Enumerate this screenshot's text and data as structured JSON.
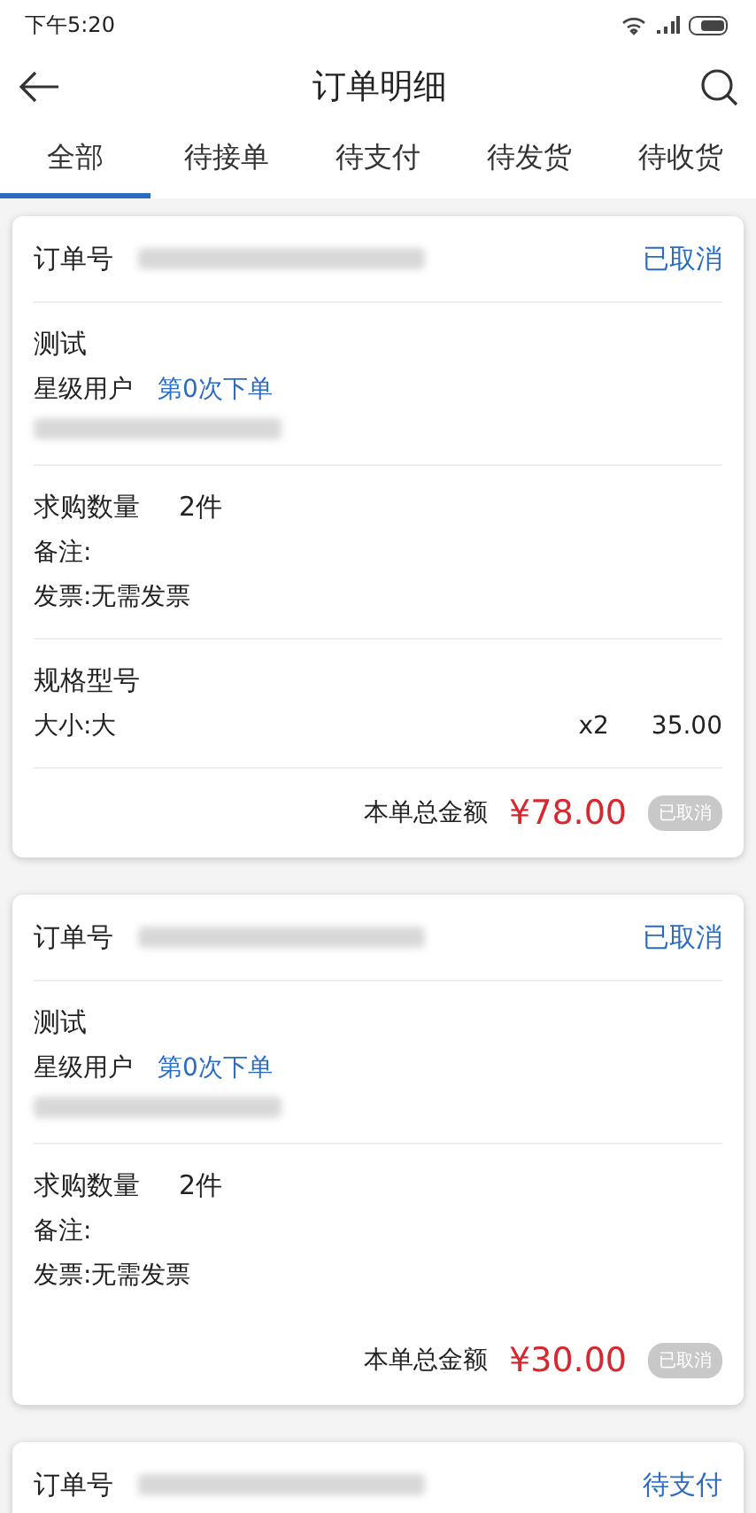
{
  "status_bar": {
    "time": "下午5:20"
  },
  "header": {
    "title": "订单明细"
  },
  "tabs": [
    {
      "label": "全部",
      "selected": true
    },
    {
      "label": "待接单",
      "selected": false
    },
    {
      "label": "待支付",
      "selected": false
    },
    {
      "label": "待发货",
      "selected": false
    },
    {
      "label": "待收货",
      "selected": false
    }
  ],
  "orders": [
    {
      "order_label": "订单号",
      "status": "已取消",
      "buyer": "测试",
      "user_level": "星级用户",
      "order_count": "第0次下单",
      "quantity_label": "求购数量",
      "quantity": "2件",
      "note": "备注:",
      "invoice": "发票:无需发票",
      "spec_title": "规格型号",
      "specs": [
        {
          "name": "大小:大",
          "count": "x2",
          "price": "35.00"
        }
      ],
      "total_label": "本单总金额",
      "total": "¥78.00",
      "badge": "已取消"
    },
    {
      "order_label": "订单号",
      "status": "已取消",
      "buyer": "测试",
      "user_level": "星级用户",
      "order_count": "第0次下单",
      "quantity_label": "求购数量",
      "quantity": "2件",
      "note": "备注:",
      "invoice": "发票:无需发票",
      "total_label": "本单总金额",
      "total": "¥30.00",
      "badge": "已取消"
    },
    {
      "order_label": "订单号",
      "status": "待支付"
    }
  ]
}
